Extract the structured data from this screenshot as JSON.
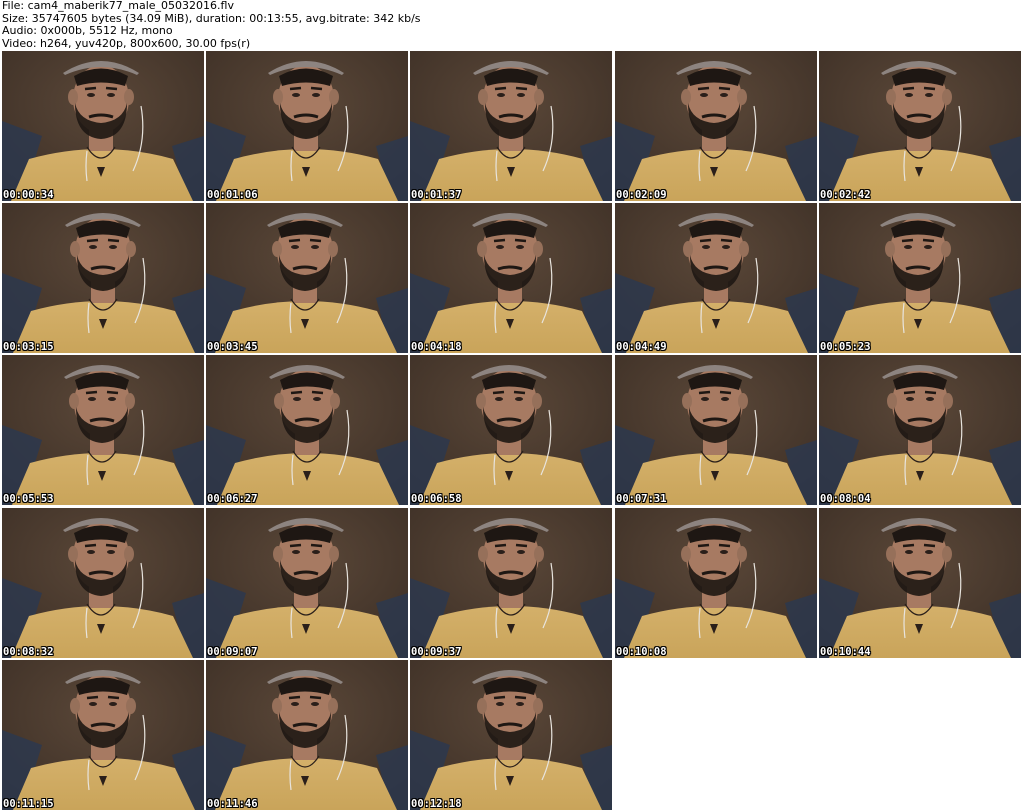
{
  "header": {
    "file_line": "File: cam4_maberik77_male_05032016.flv",
    "size_line": "Size: 35747605 bytes (34.09 MiB), duration: 00:13:55, avg.bitrate: 342 kb/s",
    "audio_line": "Audio: 0x000b, 5512 Hz, mono",
    "video_line": "Video: h264, yuv420p, 800x600, 30.00 fps(r)"
  },
  "thumbnails": [
    {
      "timestamp": "00:00:34"
    },
    {
      "timestamp": "00:01:06"
    },
    {
      "timestamp": "00:01:37"
    },
    {
      "timestamp": "00:02:09"
    },
    {
      "timestamp": "00:02:42"
    },
    {
      "timestamp": "00:03:15"
    },
    {
      "timestamp": "00:03:45"
    },
    {
      "timestamp": "00:04:18"
    },
    {
      "timestamp": "00:04:49"
    },
    {
      "timestamp": "00:05:23"
    },
    {
      "timestamp": "00:05:53"
    },
    {
      "timestamp": "00:06:27"
    },
    {
      "timestamp": "00:06:58"
    },
    {
      "timestamp": "00:07:31"
    },
    {
      "timestamp": "00:08:04"
    },
    {
      "timestamp": "00:08:32"
    },
    {
      "timestamp": "00:09:07"
    },
    {
      "timestamp": "00:09:37"
    },
    {
      "timestamp": "00:10:08"
    },
    {
      "timestamp": "00:10:44"
    },
    {
      "timestamp": "00:11:15"
    },
    {
      "timestamp": "00:11:46"
    },
    {
      "timestamp": "00:12:18"
    }
  ],
  "colors": {
    "background_wall": "#3a2d24",
    "shirt": "#c9a45a",
    "skin": "#a77a62",
    "cap": "#8d8480",
    "hair": "#1e1713",
    "pillow": "#2a3850"
  }
}
